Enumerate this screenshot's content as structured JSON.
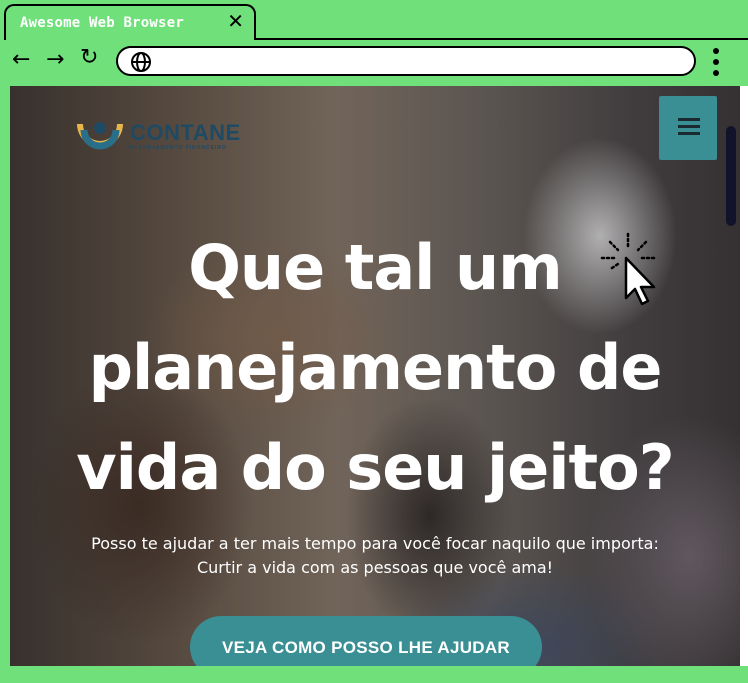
{
  "browser": {
    "tab_title": "Awesome Web Browser",
    "tab_close_icon": "close-icon",
    "back_icon": "←",
    "forward_icon": "→",
    "reload_icon": "↻",
    "address_icon": "globe-icon",
    "address_value": "",
    "menu_icon": "kebab-menu-icon",
    "chrome_color": "#6fe07a"
  },
  "page": {
    "logo": {
      "name": "CONTANE",
      "tagline": "PLANEJAMENTO FINANCEIRO"
    },
    "menu_button_icon": "hamburger-icon",
    "headline_line1": "Que tal um",
    "headline_line2": "planejamento de",
    "headline_line3": "vida do seu jeito?",
    "subtext_line1": "Posso te ajudar a ter mais tempo para você focar naquilo que importa:",
    "subtext_line2": "Curtir a vida com as pessoas que você ama!",
    "cta_label": "VEJA COMO POSSO LHE AJUDAR",
    "accent_color": "#3a8f94",
    "brand_color": "#1f4a63"
  }
}
